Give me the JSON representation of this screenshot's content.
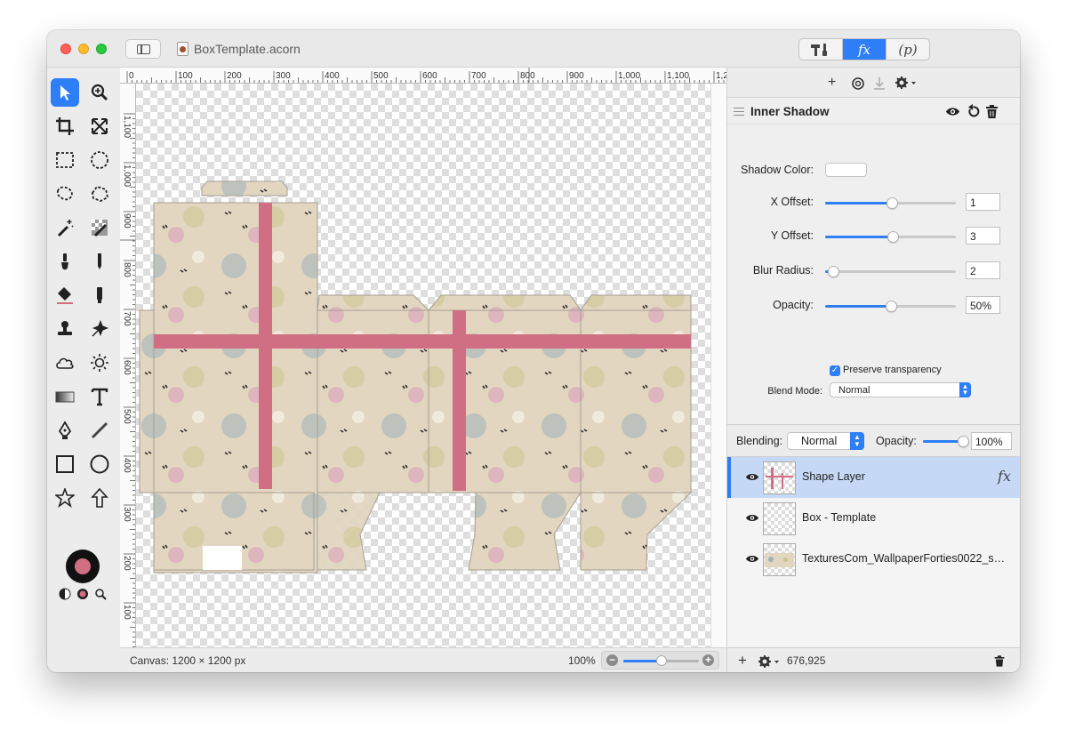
{
  "window": {
    "title": "BoxTemplate.acorn",
    "inspector_tabs": [
      "tools-icon",
      "fx",
      "(p)"
    ],
    "fx_tab_label": "fx",
    "p_tab_label": "(p)"
  },
  "toolbox": {
    "tools": [
      "select-arrow-icon",
      "zoom-icon",
      "crop-icon",
      "resize-icon",
      "rect-marquee-icon",
      "ellipse-marquee-icon",
      "lasso-icon",
      "polygon-lasso-icon",
      "magic-wand-icon",
      "instant-alpha-icon",
      "brush-icon",
      "pencil-icon",
      "paint-bucket-icon",
      "smudge-icon",
      "clone-stamp-icon",
      "retouch-icon",
      "cloud-icon",
      "sun-icon",
      "gradient-icon",
      "text-icon",
      "pen-icon",
      "line-icon",
      "rectangle-shape-icon",
      "oval-shape-icon",
      "star-icon",
      "arrow-icon"
    ],
    "foreground_color": "#111111",
    "background_color": "#d06f84"
  },
  "rulers": {
    "top_labels": [
      "0",
      "100",
      "200",
      "300",
      "400",
      "500",
      "600",
      "700",
      "800",
      "900",
      "1,000",
      "1,100",
      "1,2"
    ],
    "left_labels": [
      "1,100",
      "1,000",
      "900",
      "800",
      "700",
      "600",
      "500",
      "400",
      "300",
      "200",
      "100"
    ]
  },
  "status": {
    "canvas_size": "Canvas: 1200 × 1200 px",
    "zoom": "100%",
    "zoom_fraction": 0.5,
    "coordinates": "676,925"
  },
  "filter": {
    "title": "Inner Shadow",
    "shadow_color_label": "Shadow Color:",
    "shadow_color": "#ffffff",
    "params": [
      {
        "label": "X Offset:",
        "value": "1",
        "fraction": 0.51
      },
      {
        "label": "Y Offset:",
        "value": "3",
        "fraction": 0.52
      },
      {
        "label": "Blur Radius:",
        "value": "2",
        "fraction": 0.06
      },
      {
        "label": "Opacity:",
        "value": "50%",
        "fraction": 0.5
      }
    ],
    "preserve_transparency_label": "Preserve transparency",
    "preserve_transparency": true,
    "blend_mode_label": "Blend Mode:",
    "blend_mode": "Normal"
  },
  "layer_blending": {
    "blending_label": "Blending:",
    "blending_value": "Normal",
    "opacity_label": "Opacity:",
    "opacity_value": "100%",
    "opacity_fraction": 1.0
  },
  "layers": [
    {
      "name": "Shape Layer",
      "selected": true,
      "has_fx": true,
      "fx_label": "fx"
    },
    {
      "name": "Box - Template",
      "selected": false,
      "has_fx": false
    },
    {
      "name": "TexturesCom_WallpaperForties0022_s…",
      "selected": false,
      "has_fx": false
    }
  ],
  "colors": {
    "accent": "#2d7ef7",
    "ribbon": "#d06f84",
    "paper": "#e2d6c0"
  }
}
